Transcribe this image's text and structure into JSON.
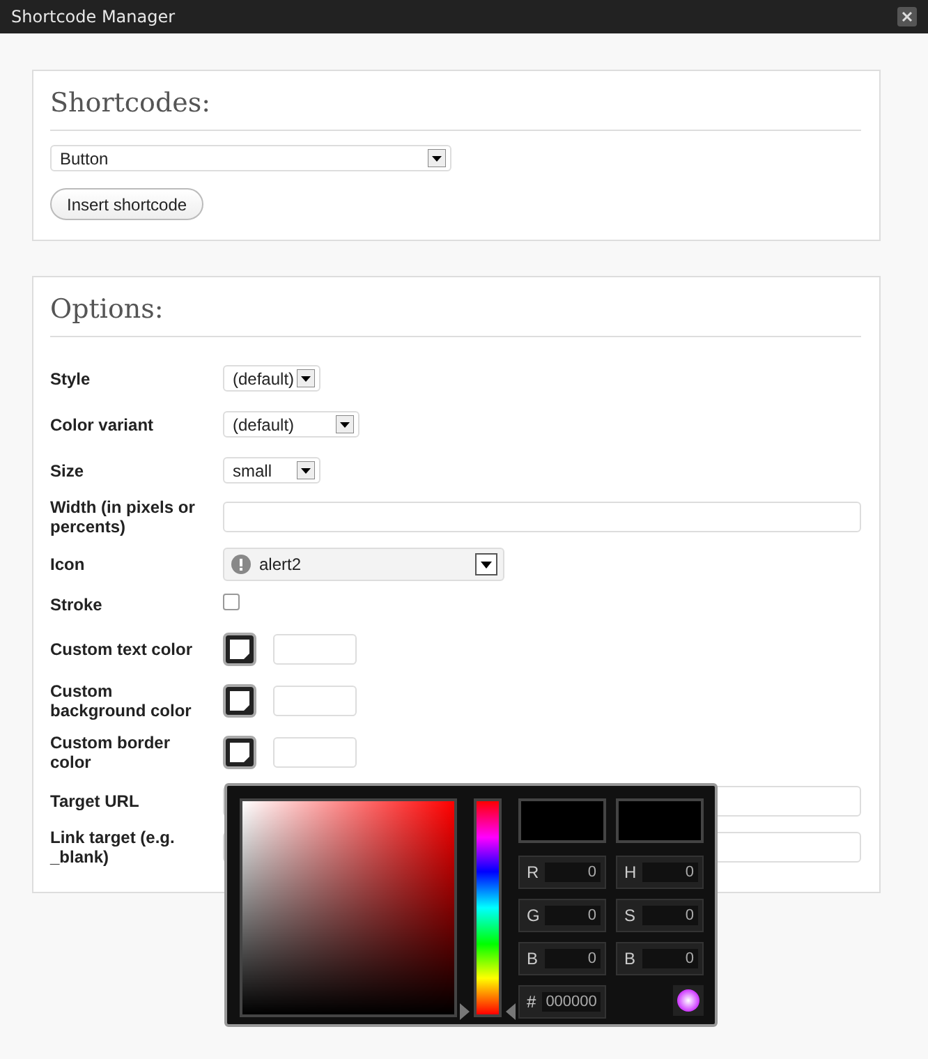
{
  "window": {
    "title": "Shortcode Manager"
  },
  "shortcodes": {
    "heading": "Shortcodes:",
    "select_value": "Button",
    "insert_button": "Insert shortcode"
  },
  "options": {
    "heading": "Options:",
    "fields": [
      {
        "kind": "select",
        "label": "Style",
        "value": "(default)"
      },
      {
        "kind": "select",
        "label": "Color variant",
        "value": "(default)"
      },
      {
        "kind": "select",
        "label": "Size",
        "value": "small"
      },
      {
        "kind": "text",
        "label": "Width (in pixels or percents)"
      },
      {
        "kind": "icon_select",
        "label": "Icon",
        "value": "alert2"
      },
      {
        "kind": "checkbox",
        "label": "Stroke",
        "checked": false
      },
      {
        "kind": "color",
        "label": "Custom text color"
      },
      {
        "kind": "color",
        "label": "Custom background color"
      },
      {
        "kind": "color",
        "label": "Custom border color"
      },
      {
        "kind": "text",
        "label": "Target URL"
      },
      {
        "kind": "text",
        "label": "Link target (e.g. _blank)"
      }
    ]
  },
  "color_picker": {
    "hue": {
      "level": 0
    },
    "channels": [
      {
        "label": "R",
        "value": "0"
      },
      {
        "label": "H",
        "value": "0"
      },
      {
        "label": "G",
        "value": "0"
      },
      {
        "label": "S",
        "value": "0"
      },
      {
        "label": "B",
        "value": "0"
      },
      {
        "label": "B",
        "value": "0"
      }
    ],
    "hex_label": "#",
    "hex_value": "000000"
  }
}
